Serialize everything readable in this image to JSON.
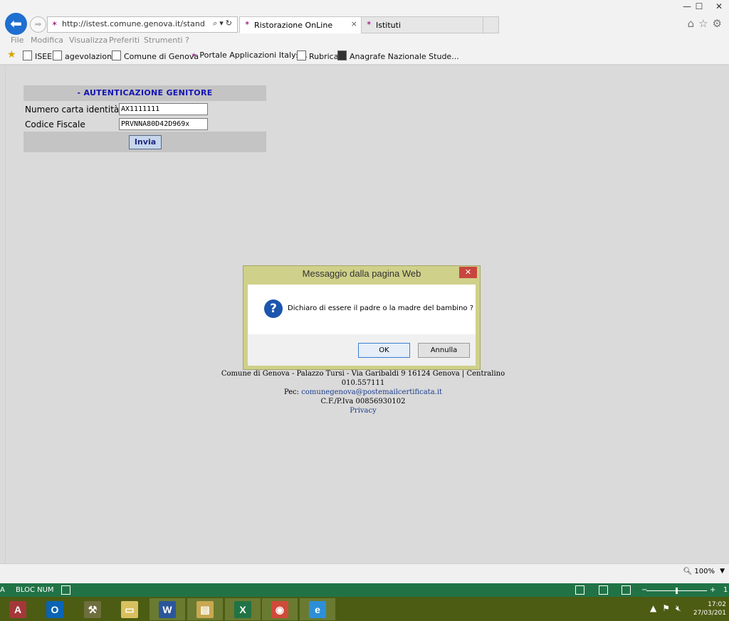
{
  "window_controls": {
    "minimize": "—",
    "maximize": "☐",
    "close": "✕"
  },
  "browser": {
    "url": "http://istest.comune.genova.it/standard.asp",
    "tabs": [
      {
        "label": "Ristorazione OnLine",
        "active": true
      },
      {
        "label": "Istituti",
        "active": false
      }
    ],
    "menu": [
      "File",
      "Modifica",
      "Visualizza",
      "Preferiti",
      "Strumenti",
      "?"
    ],
    "favorites": [
      {
        "label": "ISEE",
        "icon": "page-icon"
      },
      {
        "label": "agevolazione",
        "icon": "page-icon"
      },
      {
        "label": "Comune di Genova",
        "icon": "page-icon"
      },
      {
        "label": "Portale Applicazioni Italys...",
        "icon": "ie-icon"
      },
      {
        "label": "Rubrica",
        "icon": "page-icon"
      },
      {
        "label": "Anagrafe Nazionale Stude...",
        "icon": "calendar-icon"
      }
    ]
  },
  "auth": {
    "title": "- AUTENTICAZIONE GENITORE",
    "fields": [
      {
        "label": "Numero carta identità",
        "value": "AX1111111"
      },
      {
        "label": "Codice Fiscale",
        "value": "PRVNNA80D42D969x"
      }
    ],
    "submit_label": "Invia"
  },
  "footer": {
    "line1": "Comune di Genova - Palazzo Tursi - Via Garibaldi 9 16124 Genova | Centralino 010.557111",
    "pec_label": "Pec:",
    "pec_email": "comunegenova@postemailcertificata.it",
    "vat": "C.F./P.Iva 00856930102",
    "privacy": "Privacy"
  },
  "dialog": {
    "title": "Messaggio dalla pagina Web",
    "close": "✕",
    "message": "Dichiaro di essere il padre o la madre del bambino ?",
    "ok_label": "OK",
    "cancel_label": "Annulla"
  },
  "statusbar": {
    "zoom": "100%"
  },
  "office_bar": {
    "left_text": "A",
    "mode": "BLOC NUM",
    "right_text": "1"
  },
  "taskbar": {
    "apps": [
      {
        "name": "access",
        "glyph": "A",
        "color": "#a4373a"
      },
      {
        "name": "outlook",
        "glyph": "O",
        "color": "#0a64b4"
      },
      {
        "name": "tools",
        "glyph": "⚒",
        "color": "#6e6e3e"
      },
      {
        "name": "folder",
        "glyph": "▭",
        "color": "#d8c060"
      },
      {
        "name": "word",
        "glyph": "W",
        "color": "#2b579a"
      },
      {
        "name": "explorer",
        "glyph": "▤",
        "color": "#c8a850"
      },
      {
        "name": "excel",
        "glyph": "X",
        "color": "#217346"
      },
      {
        "name": "chrome",
        "glyph": "◉",
        "color": "#d04a3a"
      },
      {
        "name": "internet-explorer",
        "glyph": "e",
        "color": "#2d8fd8"
      }
    ],
    "time": "17:02",
    "date": "27/03/201"
  }
}
